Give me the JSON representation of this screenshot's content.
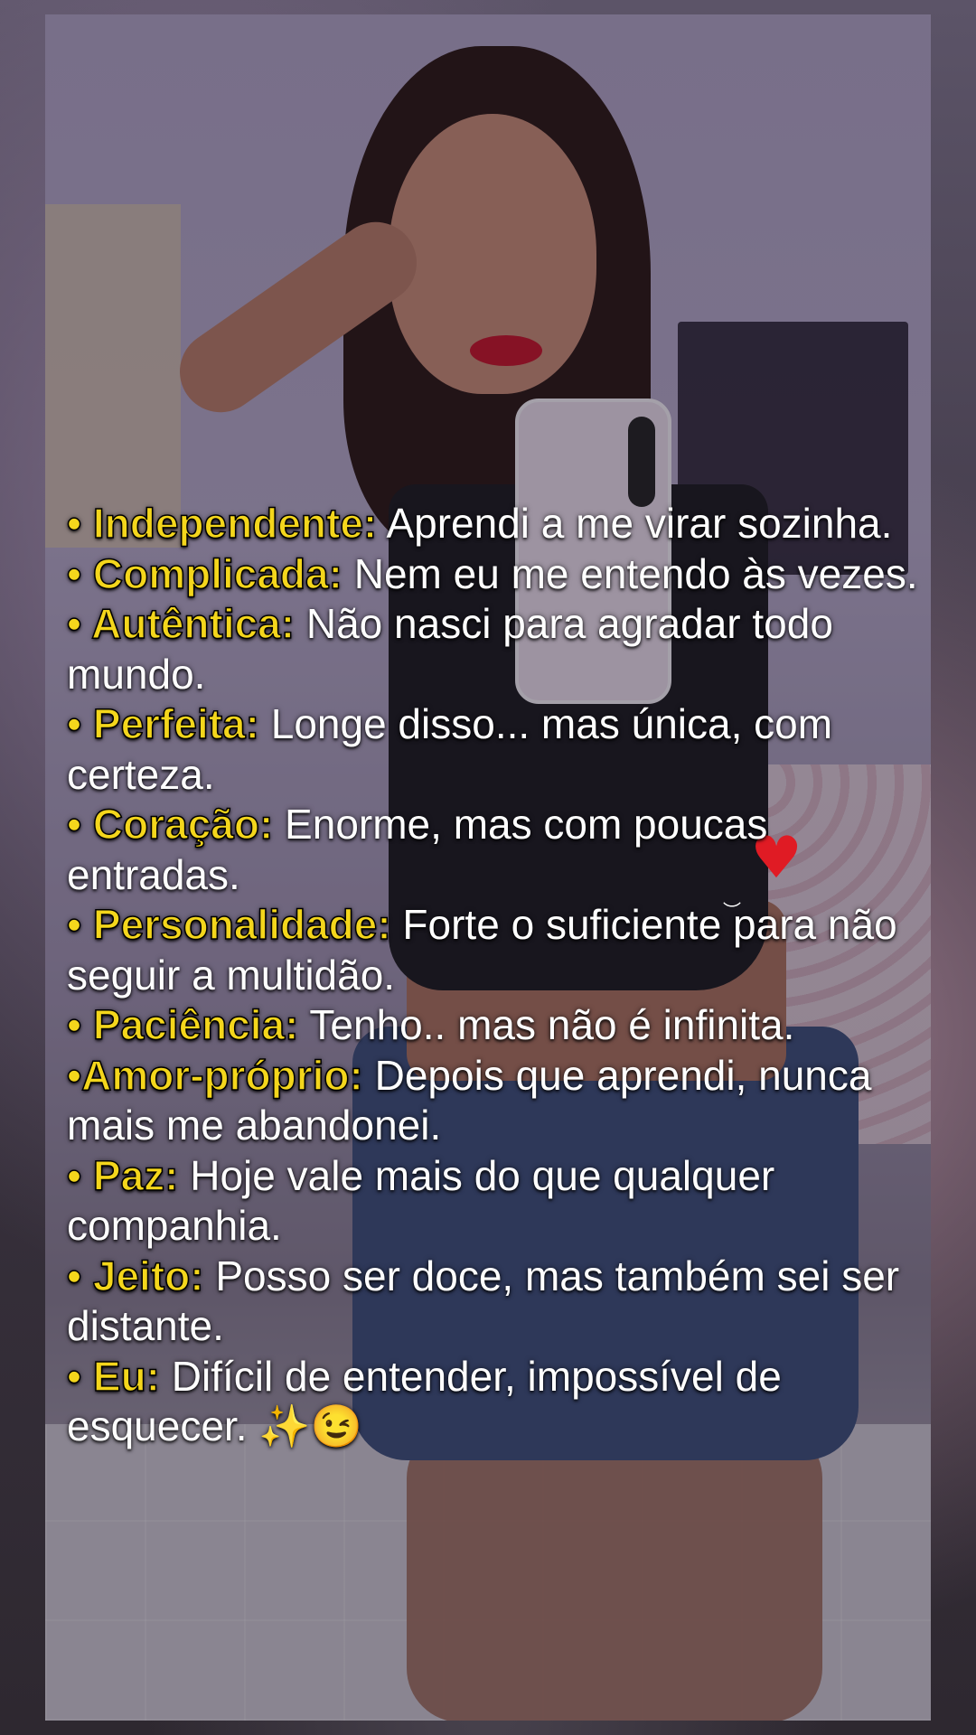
{
  "entries": [
    {
      "key": "• Independente:",
      "value": " Aprendi a me virar sozinha."
    },
    {
      "key": "• Complicada:",
      "value": " Nem eu me entendo às vezes."
    },
    {
      "key": "• Autêntica:",
      "value": " Não nasci para agradar todo mundo."
    },
    {
      "key": "• Perfeita:",
      "value": " Longe disso... mas única, com certeza."
    },
    {
      "key": "• Coração:",
      "value": " Enorme, mas com poucas entradas."
    },
    {
      "key": "• Personalidade:",
      "value": " Forte o suficiente para não seguir a multidão."
    },
    {
      "key": "• Paciência:",
      "value": " Tenho.. mas não é infinita."
    },
    {
      "key": "•Amor-próprio:",
      "value": " Depois que aprendi, nunca mais me abandonei."
    },
    {
      "key": "• Paz:",
      "value": " Hoje vale mais do que qualquer companhia."
    },
    {
      "key": "• Jeito:",
      "value": " Posso ser doce, mas também sei ser distante."
    },
    {
      "key": "• Eu:",
      "value": " Difícil de entender, impossível de esquecer. ✨😉"
    }
  ],
  "sticker": {
    "icon": "heart-icon",
    "color": "#e01b24"
  },
  "colors": {
    "key_text": "#f4d61c",
    "value_text": "#ffffff"
  }
}
